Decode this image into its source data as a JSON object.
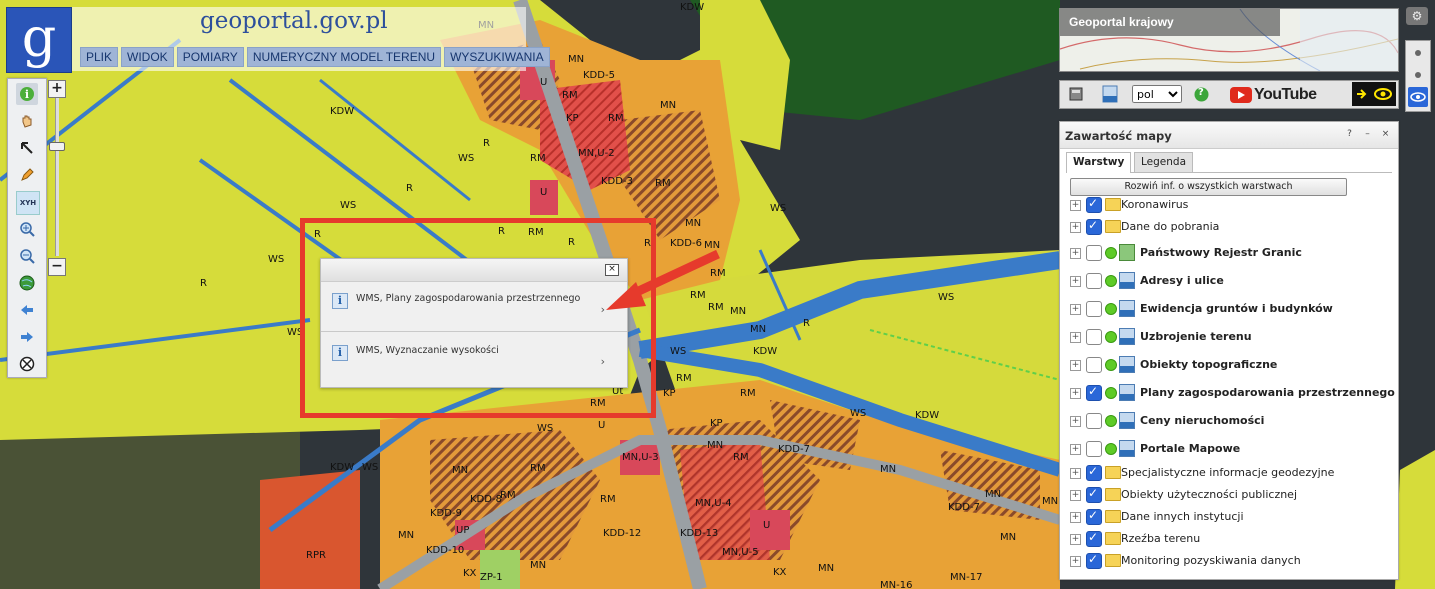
{
  "app": {
    "logo_text": "geoportal.gov.pl",
    "menu": [
      "PLIK",
      "WIDOK",
      "POMIARY",
      "NUMERYCZNY MODEL TERENU",
      "WYSZUKIWANIA"
    ]
  },
  "toolbar": {
    "tools": [
      "info-icon",
      "pan-hand-icon",
      "select-arrow-icon",
      "draw-pencil-icon",
      "xyh-coordinates-icon",
      "zoom-in-icon",
      "zoom-out-icon",
      "globe-icon",
      "back-arrow-icon",
      "forward-arrow-icon",
      "cancel-icon"
    ],
    "xyh_label": "XYH",
    "zoom_in": "+",
    "zoom_out": "−"
  },
  "overview": {
    "title": "Geoportal krajowy"
  },
  "utility": {
    "language": "pol",
    "language_options": [
      "pol"
    ],
    "youtube": "YouTube",
    "help": "?"
  },
  "popup": {
    "close": "×",
    "items": [
      {
        "label": "WMS, Plany zagospodarowania przestrzennego",
        "arrow": "›"
      },
      {
        "label": "WMS, Wyznaczanie wysokości",
        "arrow": "›"
      }
    ]
  },
  "panel": {
    "title": "Zawartość mapy",
    "buttons": [
      "?",
      "–",
      "×"
    ],
    "tabs": [
      "Warstwy",
      "Legenda"
    ],
    "active_tab": "Warstwy",
    "expand_all": "Rozwiń inf. o wszystkich warstwach",
    "layers": [
      {
        "label": "Koronawirus",
        "checked": true,
        "kind": "folder",
        "bold": false
      },
      {
        "label": "Dane do pobrania",
        "checked": true,
        "kind": "folder",
        "bold": false
      },
      {
        "label": "Państwowy Rejestr Granic",
        "checked": false,
        "kind": "green",
        "bold": true
      },
      {
        "label": "Adresy i ulice",
        "checked": false,
        "kind": "wms",
        "bold": true
      },
      {
        "label": "Ewidencja gruntów i budynków",
        "checked": false,
        "kind": "wms",
        "bold": true
      },
      {
        "label": "Uzbrojenie terenu",
        "checked": false,
        "kind": "wms",
        "bold": true
      },
      {
        "label": "Obiekty topograficzne",
        "checked": false,
        "kind": "wms",
        "bold": true
      },
      {
        "label": "Plany zagospodarowania przestrzennego",
        "checked": true,
        "kind": "wms",
        "bold": true
      },
      {
        "label": "Ceny nieruchomości",
        "checked": false,
        "kind": "wms",
        "bold": true
      },
      {
        "label": "Portale Mapowe",
        "checked": false,
        "kind": "wms",
        "bold": true
      },
      {
        "label": "Specjalistyczne informacje geodezyjne",
        "checked": true,
        "kind": "folder",
        "bold": false
      },
      {
        "label": "Obiekty użyteczności publicznej",
        "checked": true,
        "kind": "folder",
        "bold": false
      },
      {
        "label": "Dane innych instytucji",
        "checked": true,
        "kind": "folder",
        "bold": false
      },
      {
        "label": "Rzeźba terenu",
        "checked": true,
        "kind": "folder",
        "bold": false
      },
      {
        "label": "Monitoring pozyskiwania danych",
        "checked": true,
        "kind": "folder",
        "bold": false
      }
    ]
  },
  "map_labels": [
    "MN",
    "MN",
    "RM",
    "MN",
    "KDD-5",
    "RM",
    "KP",
    "MN,U-2",
    "RM",
    "R",
    "KDW",
    "WS",
    "R",
    "WS",
    "R",
    "R",
    "WS",
    "R",
    "KDW",
    "WS",
    "WS",
    "R",
    "RM",
    "RM",
    "R",
    "KDD-3",
    "KDW",
    "U",
    "U",
    "WS",
    "WS",
    "RM",
    "MN",
    "RM",
    "MN",
    "KDD-6",
    "MN",
    "RM",
    "MN",
    "R",
    "KDW",
    "WS",
    "KDW",
    "WS",
    "KDW",
    "RM",
    "RM",
    "Ut",
    "RM",
    "KP",
    "U",
    "WS",
    "MN",
    "RM",
    "MN,U-3",
    "KDD-7",
    "KP",
    "MN",
    "RM",
    "MN",
    "RM",
    "KDD-8",
    "RM",
    "MN,U-4",
    "KDD-12",
    "KDD-13",
    "MN,U-5",
    "UP",
    "RPR",
    "MN",
    "KX",
    "ZP-1",
    "MN",
    "KX",
    "MN",
    "KDD-9",
    "KDD-10",
    "MN-16",
    "MN-17",
    "MN",
    "U",
    "MN",
    "MN",
    "KDD-7"
  ],
  "colors": {
    "agri_yellow": "#dcdc3c",
    "residential_orange": "#e8a236",
    "water_blue": "#3a7bc8",
    "service_red": "#d8485a",
    "highlight_red": "#e63a2c",
    "satellite_dark": "#2c3136",
    "accent_blue": "#2a67d8"
  }
}
